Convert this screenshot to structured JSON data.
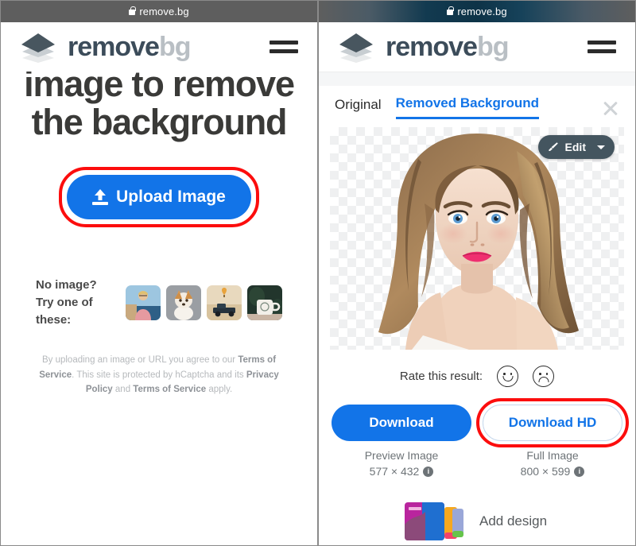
{
  "left": {
    "urlbar": {
      "text": "remove.bg",
      "icon": "lock-icon"
    },
    "brand": {
      "part1": "remove",
      "part2": "bg"
    },
    "headline": "image to remove the background",
    "upload_button": {
      "label": "Upload Image",
      "icon": "upload-icon"
    },
    "try": {
      "line1": "No image?",
      "line2": "Try one of these:",
      "thumbnails": [
        "man-pink-shirt",
        "corgi-dog",
        "truck-balloon",
        "coffee-mug"
      ]
    },
    "legal": {
      "t1": "By uploading an image or URL you agree to our ",
      "b1": "Terms of Service",
      "t2": ". This site is protected by hCaptcha and its ",
      "b2": "Privacy Policy",
      "t3": " and ",
      "b3": "Terms of Service",
      "t4": " apply."
    }
  },
  "right": {
    "urlbar": {
      "text": "remove.bg",
      "icon": "lock-icon"
    },
    "brand": {
      "part1": "remove",
      "part2": "bg"
    },
    "tabs": [
      {
        "label": "Original",
        "active": false
      },
      {
        "label": "Removed Background",
        "active": true
      }
    ],
    "close_label": "close-icon",
    "edit_button": {
      "label": "Edit",
      "icon": "brush-icon",
      "caret": "chevron-down-icon"
    },
    "rate": {
      "label": "Rate this result:",
      "positive": "smiley-face-icon",
      "negative": "frowny-face-icon"
    },
    "downloads": [
      {
        "label": "Download",
        "caption": "Preview Image",
        "dimensions": "577 × 432",
        "info": "i",
        "style": "primary"
      },
      {
        "label": "Download HD",
        "caption": "Full Image",
        "dimensions": "800 × 599",
        "info": "i",
        "style": "secondary",
        "highlighted": true
      }
    ],
    "add_design": {
      "label": "Add design",
      "thumb": "design-card-thumb"
    }
  },
  "colors": {
    "accent_blue": "#1274e8",
    "brand_dark": "#3c4c5a",
    "brand_light": "#b9bfc4",
    "annotation_red": "#fc0d0d",
    "edit_slate": "#44555f",
    "chrome_gray": "#5e5e5e"
  }
}
